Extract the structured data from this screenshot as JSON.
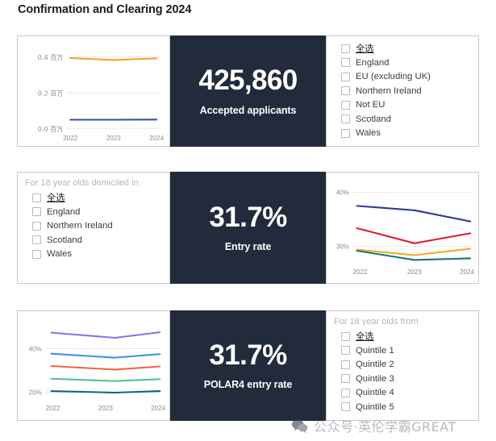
{
  "page": {
    "title": "Confirmation and Clearing 2024",
    "background": "#ffffff",
    "kpi_background": "#212B3B",
    "watermark": "公众号·英伦学霸GREAT",
    "watermark_icon": "wechat-icon"
  },
  "rows": [
    {
      "id": "row-1",
      "kpi": {
        "value": "425,860",
        "label": "Accepted applicants"
      },
      "filter": {
        "header": "",
        "items": [
          "全选",
          "England",
          "EU (excluding UK)",
          "Northern Ireland",
          "Not EU",
          "Scotland",
          "Wales"
        ]
      }
    },
    {
      "id": "row-2",
      "kpi": {
        "value": "31.7%",
        "label": "Entry rate"
      },
      "filter": {
        "header": "For 18 year olds domiciled in",
        "items": [
          "全选",
          "England",
          "Northern Ireland",
          "Scotland",
          "Wales"
        ]
      }
    },
    {
      "id": "row-3",
      "kpi": {
        "value": "31.7%",
        "label": "POLAR4 entry rate"
      },
      "filter": {
        "header": "For 18 year olds from",
        "items": [
          "全选",
          "Quintile 1",
          "Quintile 2",
          "Quintile 3",
          "Quintile 4",
          "Quintile 5"
        ]
      }
    }
  ],
  "chart_data": [
    {
      "id": "chart-accepted-applicants",
      "type": "line",
      "title": "",
      "xlabel": "",
      "ylabel": "",
      "x": [
        "2022",
        "2023",
        "2024"
      ],
      "ytick_labels": [
        "0.0 百万",
        "0.2 百万",
        "0.4 百万"
      ],
      "ytick_values": [
        0.0,
        0.2,
        0.4
      ],
      "ylim": [
        0.0,
        0.44
      ],
      "grid": true,
      "legend": "none",
      "series": [
        {
          "name": "England",
          "color": "#F0A32A",
          "values": [
            0.382,
            0.371,
            0.38
          ]
        },
        {
          "name": "Not EU",
          "color": "#3B4CA8",
          "values": [
            0.049,
            0.049,
            0.05
          ]
        }
      ]
    },
    {
      "id": "chart-entry-rate",
      "type": "line",
      "title": "",
      "xlabel": "",
      "ylabel": "",
      "x": [
        "2022",
        "2023",
        "2024"
      ],
      "ytick_labels": [
        "30%",
        "40%"
      ],
      "ytick_values": [
        30,
        40
      ],
      "ylim": [
        26.5,
        41.5
      ],
      "grid": true,
      "legend": "none",
      "series": [
        {
          "name": "Northern Ireland",
          "color": "#2E3A91",
          "values": [
            37.5,
            36.7,
            34.6
          ]
        },
        {
          "name": "Scotland",
          "color": "#E01B2E",
          "values": [
            33.4,
            30.6,
            32.5
          ]
        },
        {
          "name": "England",
          "color": "#F5A623",
          "values": [
            29.4,
            28.4,
            29.6
          ]
        },
        {
          "name": "Wales",
          "color": "#12797F",
          "values": [
            29.2,
            27.5,
            27.8
          ]
        }
      ]
    },
    {
      "id": "chart-polar4-entry-rate",
      "type": "line",
      "title": "",
      "xlabel": "",
      "ylabel": "",
      "x": [
        "2022",
        "2023",
        "2024"
      ],
      "ytick_labels": [
        "20%",
        "40%"
      ],
      "ytick_values": [
        20,
        40
      ],
      "ylim": [
        16.5,
        50
      ],
      "grid": true,
      "legend": "none",
      "series": [
        {
          "name": "Quintile 5",
          "color": "#8B6FE8",
          "values": [
            46.0,
            43.6,
            46.2
          ]
        },
        {
          "name": "Quintile 4",
          "color": "#3B92E0",
          "values": [
            36.8,
            34.9,
            36.5
          ]
        },
        {
          "name": "Quintile 3",
          "color": "#F1644B",
          "values": [
            31.5,
            29.8,
            31.3
          ]
        },
        {
          "name": "Quintile 2",
          "color": "#5CBD92",
          "values": [
            25.8,
            24.6,
            25.6
          ]
        },
        {
          "name": "Quintile 1",
          "color": "#12686E",
          "values": [
            20.4,
            19.7,
            20.5
          ]
        }
      ]
    }
  ]
}
